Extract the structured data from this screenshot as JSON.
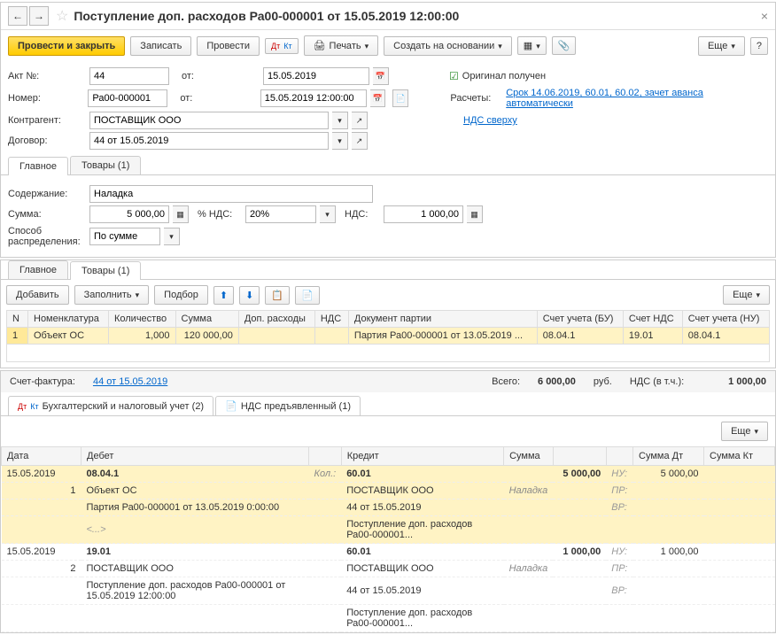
{
  "header": {
    "title": "Поступление доп. расходов Ра00-000001 от 15.05.2019 12:00:00"
  },
  "toolbar": {
    "post_close": "Провести и закрыть",
    "write": "Записать",
    "post": "Провести",
    "print": "Печать",
    "create_based": "Создать на основании",
    "more": "Еще"
  },
  "fields": {
    "act_no_label": "Акт №:",
    "act_no": "44",
    "from_label": "от:",
    "act_date": "15.05.2019",
    "original_received": "Оригинал получен",
    "number_label": "Номер:",
    "number": "Ра00-000001",
    "doc_date": "15.05.2019 12:00:00",
    "calc_label": "Расчеты:",
    "calc_link": "Срок 14.06.2019, 60.01, 60.02, зачет аванса автоматически",
    "contractor_label": "Контрагент:",
    "contractor": "ПОСТАВЩИК ООО",
    "vat_link": "НДС сверху",
    "contract_label": "Договор:",
    "contract": "44 от 15.05.2019"
  },
  "tabs_main": {
    "main": "Главное",
    "goods": "Товары (1)"
  },
  "main_tab": {
    "content_label": "Содержание:",
    "content": "Наладка",
    "sum_label": "Сумма:",
    "sum": "5 000,00",
    "vat_pct_label": "% НДС:",
    "vat_pct": "20%",
    "vat_label": "НДС:",
    "vat": "1 000,00",
    "distrib_label": "Способ распределения:",
    "distrib": "По сумме"
  },
  "goods_toolbar": {
    "add": "Добавить",
    "fill": "Заполнить",
    "pick": "Подбор",
    "more": "Еще"
  },
  "goods_table": {
    "headers": {
      "n": "N",
      "nomenclature": "Номенклатура",
      "qty": "Количество",
      "sum": "Сумма",
      "extra": "Доп. расходы",
      "vat": "НДС",
      "party_doc": "Документ партии",
      "acct_bu": "Счет учета (БУ)",
      "acct_vat": "Счет НДС",
      "acct_nu": "Счет учета (НУ)"
    },
    "row": {
      "n": "1",
      "nomenclature": "Объект ОС",
      "qty": "1,000",
      "sum": "120 000,00",
      "party_doc": "Партия Ра00-000001 от 13.05.2019 ...",
      "acct_bu": "08.04.1",
      "acct_vat": "19.01",
      "acct_nu": "08.04.1"
    }
  },
  "totals": {
    "sf_label": "Счет-фактура:",
    "sf_link": "44 от 15.05.2019",
    "total_label": "Всего:",
    "total": "6 000,00",
    "rub": "руб.",
    "vat_incl_label": "НДС (в т.ч.):",
    "vat_incl": "1 000,00"
  },
  "acct_tabs": {
    "tab1": "Бухгалтерский и налоговый учет (2)",
    "tab2": "НДС предъявленный (1)",
    "more": "Еще"
  },
  "acct_headers": {
    "date": "Дата",
    "debit": "Дебет",
    "credit": "Кредит",
    "sum": "Сумма",
    "sum_dt": "Сумма Дт",
    "sum_kt": "Сумма Кт"
  },
  "entries": [
    {
      "date": "15.05.2019",
      "n": "1",
      "debit_acct": "08.04.1",
      "credit_acct": "60.01",
      "sum": "5 000,00",
      "sum_dt": "5 000,00",
      "kol": "Кол.:",
      "nu": "НУ:",
      "debit_sub1": "Объект ОС",
      "credit_sub1": "ПОСТАВЩИК ООО",
      "analyt": "Наладка",
      "pr": "ПР:",
      "debit_sub2": "Партия Ра00-000001 от 13.05.2019 0:00:00",
      "credit_sub2": "44 от 15.05.2019",
      "vr": "ВР:",
      "more": "<...>",
      "credit_sub3": "Поступление доп. расходов Ра00-000001..."
    },
    {
      "date": "15.05.2019",
      "n": "2",
      "debit_acct": "19.01",
      "credit_acct": "60.01",
      "sum": "1 000,00",
      "sum_dt": "1 000,00",
      "nu": "НУ:",
      "debit_sub1": "ПОСТАВЩИК ООО",
      "credit_sub1": "ПОСТАВЩИК ООО",
      "analyt": "Наладка",
      "pr": "ПР:",
      "debit_sub2": "Поступление доп. расходов Ра00-000001 от 15.05.2019 12:00:00",
      "credit_sub2": "44 от 15.05.2019",
      "vr": "ВР:",
      "credit_sub3": "Поступление доп. расходов Ра00-000001..."
    }
  ]
}
